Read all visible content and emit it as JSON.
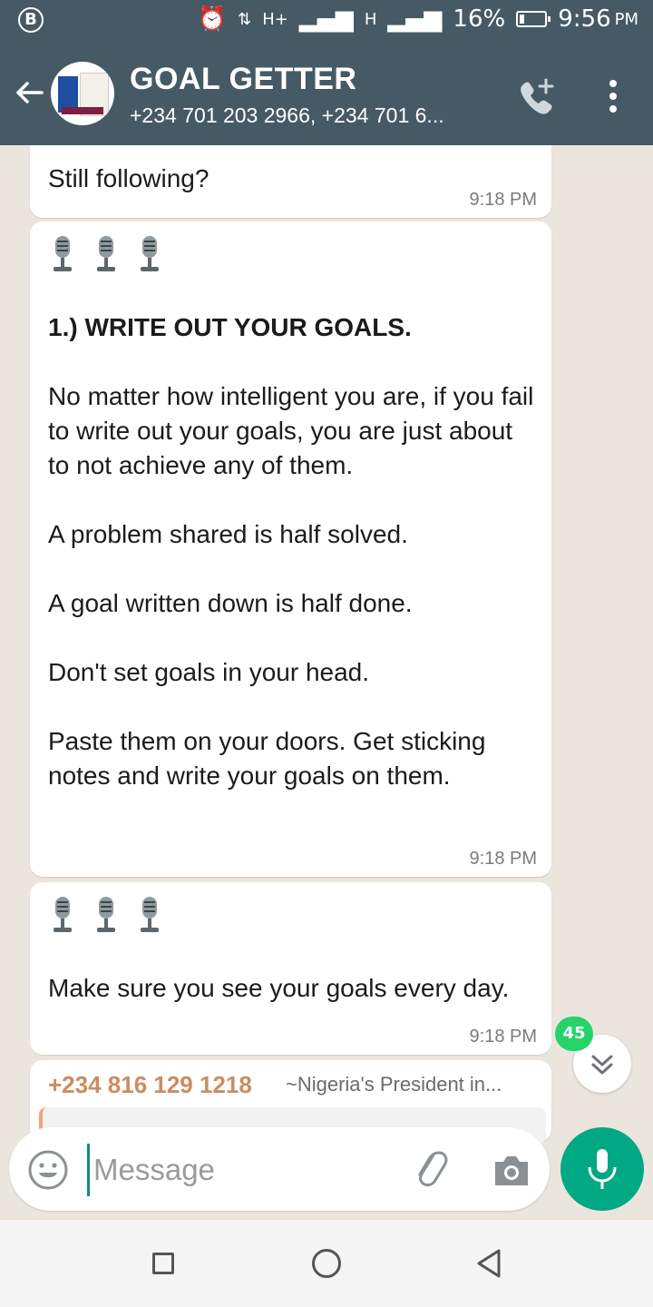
{
  "status_bar": {
    "left_badge": "B",
    "network_small": "H+",
    "network_small2": "H",
    "battery": "16%",
    "battery_fraction": 0.16,
    "time": "9:56",
    "ampm": "PM"
  },
  "header": {
    "title": "GOAL GETTER",
    "subtitle": "+234 701 203 2966, +234 701 6..."
  },
  "messages": [
    {
      "text": "Still following?",
      "time": "9:18 PM"
    },
    {
      "heading": "1.) WRITE OUT YOUR GOALS.",
      "body": "No matter how intelligent you are, if you fail to write out your goals, you are just about to not achieve any of them.\n\nA problem shared is half solved.\n\nA goal written down is half done.\n\nDon't set goals in your head.\n\nPaste them on your doors. Get sticking notes and write your goals on them.",
      "time": "9:18 PM"
    },
    {
      "body": "Make sure you see your goals every day.",
      "time": "9:18 PM"
    },
    {
      "sender": "+234 816 129 1218",
      "push_name": "~Nigeria's President in..."
    }
  ],
  "unread_count": "45",
  "input": {
    "placeholder": "Message"
  },
  "colors": {
    "header": "#455a64",
    "accent": "#00a884",
    "sender": "#c98d5f",
    "badge": "#25d366"
  }
}
